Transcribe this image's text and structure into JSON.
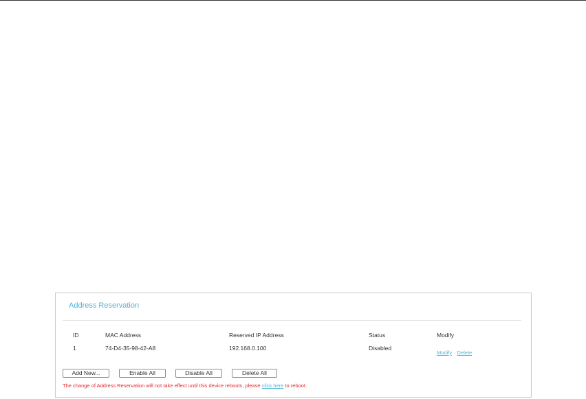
{
  "section_title": "Address Reservation",
  "table": {
    "headers": {
      "id": "ID",
      "mac": "MAC Address",
      "ip": "Reserved IP Address",
      "status": "Status",
      "modify": "Modify"
    },
    "rows": [
      {
        "id": "1",
        "mac": "74-D4-35-98-42-A8",
        "ip": "192.168.0.100",
        "status": "Disabled",
        "modify_label": "Modify",
        "delete_label": "Delete"
      }
    ]
  },
  "buttons": {
    "add_new": "Add New...",
    "enable_all": "Enable All",
    "disable_all": "Disable All",
    "delete_all": "Delete All"
  },
  "notice": {
    "before": "The change of Address Reservation will not take effect until this device reboots, please ",
    "link": "click here",
    "after": " to reboot."
  },
  "colors": {
    "title": "#4fb4d8",
    "link": "#4fb4d8",
    "notice": "#e0262b"
  }
}
